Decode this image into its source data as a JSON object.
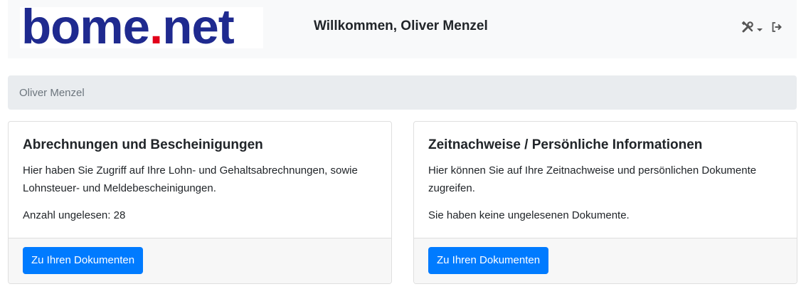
{
  "navbar": {
    "logo": {
      "text_main": "bome",
      "text_dot": ".",
      "text_tld": "net",
      "colors": {
        "main": "#1f2a8f",
        "dot": "#e2001a"
      }
    },
    "welcome": "Willkommen, Oliver Menzel",
    "tools_icon": "tools-icon",
    "logout_icon": "sign-out-icon"
  },
  "breadcrumb": {
    "label": "Oliver Menzel"
  },
  "cards": [
    {
      "title": "Abrechnungen und Bescheinigungen",
      "text": "Hier haben Sie Zugriff auf Ihre Lohn- und Gehaltsabrechnungen, sowie Lohnsteuer- und Meldebescheinigungen.",
      "extra": "Anzahl ungelesen: 28",
      "button": "Zu Ihren Dokumenten"
    },
    {
      "title": "Zeitnachweise / Persönliche Informationen",
      "text": "Hier können Sie auf Ihre Zeitnachweise und persönlichen Dokumente zugreifen.",
      "extra": "Sie haben keine ungelesenen Dokumente.",
      "button": "Zu Ihren Dokumenten"
    }
  ],
  "colors": {
    "primary": "#007bff",
    "navbar_bg": "#f8f9fa",
    "breadcrumb_bg": "#e9ecef",
    "card_footer_bg": "#f7f7f7"
  }
}
